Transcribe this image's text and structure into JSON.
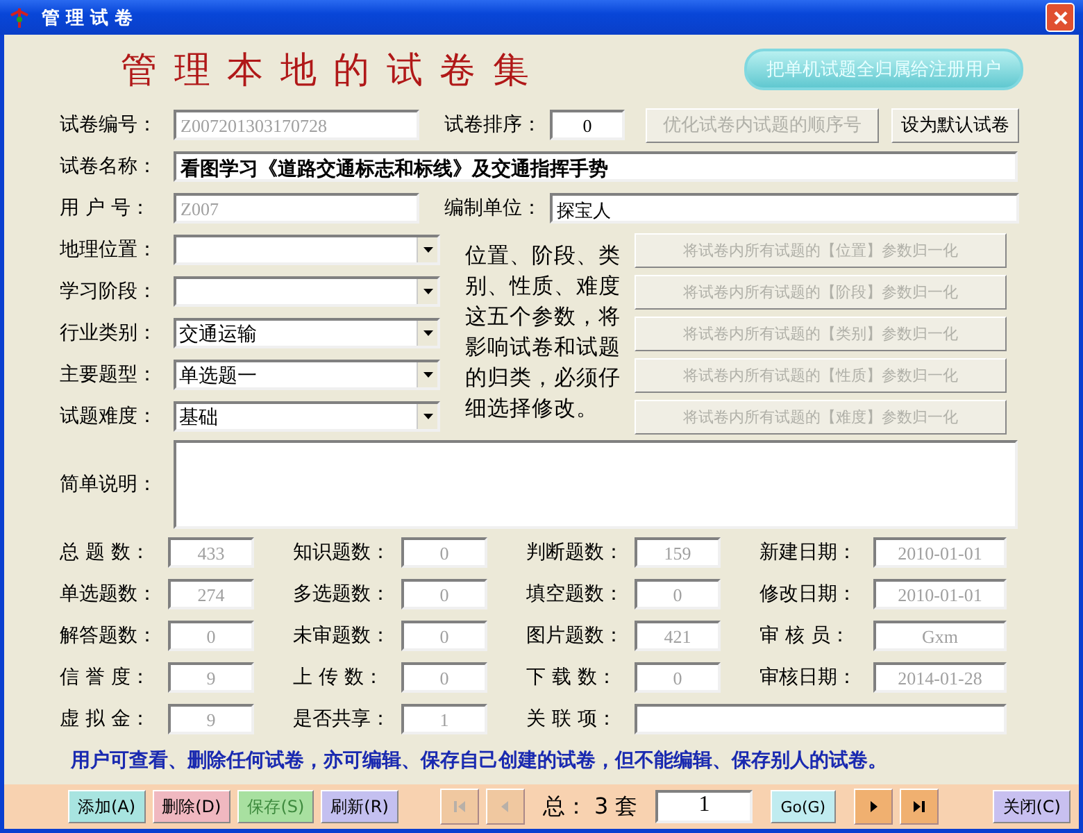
{
  "window": {
    "title": "管 理 试 卷"
  },
  "heading": "管 理 本 地 的 试 卷 集",
  "register_button": {
    "label": "把单机试题全归属给注册用户"
  },
  "paper_no": {
    "label": "试卷编号：",
    "value": "Z007201303170728",
    "disabled": true
  },
  "order": {
    "label": "试卷排序：",
    "value": "0"
  },
  "optimize_button": {
    "label": "优化试卷内试题的顺序号",
    "disabled": true
  },
  "default_button": {
    "label": "设为默认试卷",
    "disabled": false
  },
  "paper_name": {
    "label": "试卷名称：",
    "value": "看图学习《道路交通标志和标线》及交通指挥手势"
  },
  "user_no": {
    "label": "用 户 号：",
    "value": "Z007",
    "disabled": true
  },
  "unit": {
    "label": "编制单位：",
    "value": "探宝人"
  },
  "combos": [
    {
      "label": "地理位置：",
      "button": "将试卷内所有试题的【位置】参数归一化",
      "disabled": true
    },
    {
      "label": "学习阶段：",
      "button": "将试卷内所有试题的【阶段】参数归一化",
      "disabled": true
    },
    {
      "label": "行业类别：",
      "value": "交通运输",
      "button": "将试卷内所有试题的【类别】参数归一化",
      "disabled": true
    },
    {
      "label": "主要题型：",
      "value": "单选题一",
      "button": "将试卷内所有试题的【性质】参数归一化",
      "disabled": true
    },
    {
      "label": "试题难度：",
      "value": "基础",
      "button": "将试卷内所有试题的【难度】参数归一化",
      "disabled": true
    }
  ],
  "combo_note": "位置、阶段、类别、性质、难度这五个参数，将影响试卷和试题的归类，必须仔细选择修改。",
  "description": {
    "label": "简单说明："
  },
  "stats": [
    [
      {
        "kind": "number",
        "label": "总 题 数：",
        "value": "433"
      },
      {
        "kind": "number",
        "label": "知识题数：",
        "value": "0"
      },
      {
        "kind": "number",
        "label": "判断题数：",
        "value": "159"
      },
      {
        "kind": "date",
        "label": "新建日期：",
        "value": "2010-01-01"
      }
    ],
    [
      {
        "kind": "number",
        "label": "单选题数：",
        "value": "274"
      },
      {
        "kind": "number",
        "label": "多选题数：",
        "value": "0"
      },
      {
        "kind": "number",
        "label": "填空题数：",
        "value": "0"
      },
      {
        "kind": "date",
        "label": "修改日期：",
        "value": "2010-01-01"
      }
    ],
    [
      {
        "kind": "number",
        "label": "解答题数：",
        "value": "0"
      },
      {
        "kind": "number",
        "label": "未审题数：",
        "value": "0"
      },
      {
        "kind": "number",
        "label": "图片题数：",
        "value": "421"
      },
      {
        "kind": "date",
        "label": "审 核 员：",
        "value": "Gxm"
      }
    ],
    [
      {
        "kind": "number",
        "label": "信 誉 度：",
        "value": "9"
      },
      {
        "kind": "number",
        "label": "上 传 数：",
        "value": "0"
      },
      {
        "kind": "number",
        "label": "下 载 数：",
        "value": "0"
      },
      {
        "kind": "date",
        "label": "审核日期：",
        "value": "2014-01-28"
      }
    ],
    [
      {
        "kind": "number",
        "label": "虚 拟 金：",
        "value": "9"
      },
      {
        "kind": "number",
        "label": "是否共享：",
        "value": "1"
      },
      {
        "kind": "wide",
        "label": "关 联 项："
      }
    ]
  ],
  "notice": "用户可查看、删除任何试卷，亦可编辑、保存自己创建的试卷，但不能编辑、保存别人的试卷。",
  "toolbar": {
    "actions": [
      {
        "label": "添加(A)",
        "color": "#a8e4e0",
        "disabled": false
      },
      {
        "label": "删除(D)",
        "color": "#f0b8c0",
        "disabled": false
      },
      {
        "label": "保存(S)",
        "color": "#a8e0a0",
        "disabled": true
      },
      {
        "label": "刷新(R)",
        "color": "#c4c0f0",
        "disabled": false
      }
    ],
    "nav_back": [
      {
        "kind": "first",
        "disabled": true
      },
      {
        "kind": "prev",
        "disabled": true
      }
    ],
    "total": "总： 3 套",
    "page": "1",
    "go": {
      "label": "Go(G)"
    },
    "nav_forward": [
      {
        "kind": "next",
        "disabled": false
      },
      {
        "kind": "last",
        "disabled": false
      }
    ],
    "close": {
      "label": "关闭(C)"
    }
  }
}
